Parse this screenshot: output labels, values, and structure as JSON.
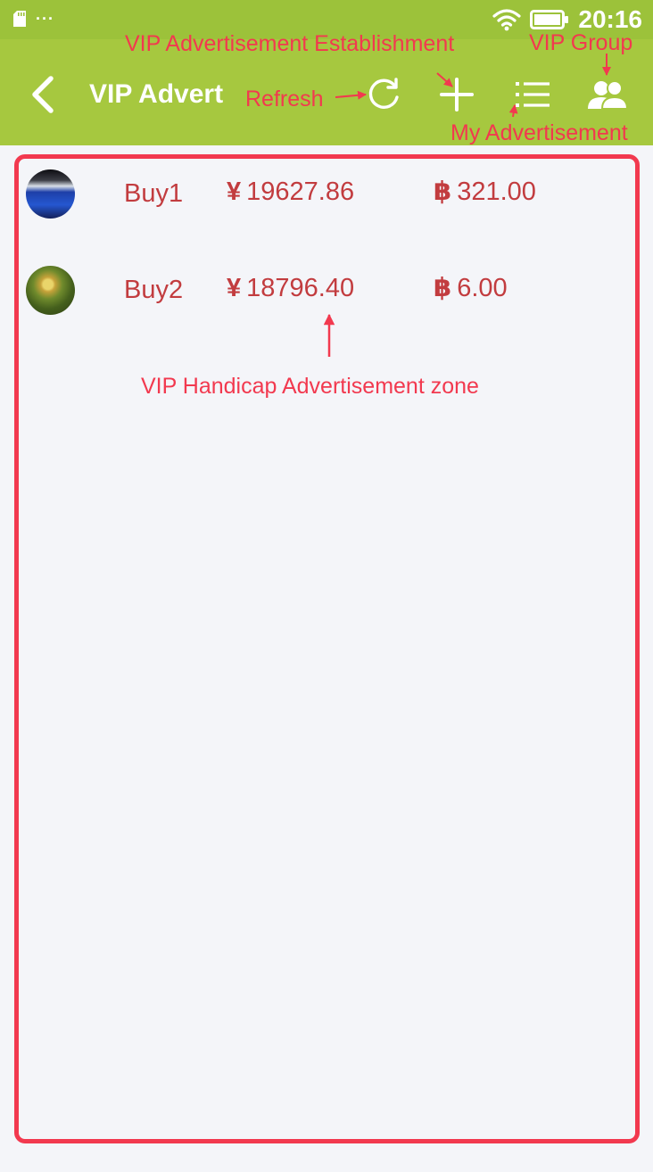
{
  "status_bar": {
    "time": "20:16",
    "more_indicator": "···",
    "icons": [
      "sd-card-icon",
      "wifi-icon",
      "battery-icon"
    ]
  },
  "app_bar": {
    "title": "VIP Advert",
    "actions": [
      "back-icon",
      "refresh-icon",
      "plus-icon",
      "list-icon",
      "group-icon"
    ]
  },
  "ads": [
    {
      "name": "Buy1",
      "currency_symbol": "¥",
      "price": "19627.86",
      "coin_symbol": "฿",
      "amount": "321.00"
    },
    {
      "name": "Buy2",
      "currency_symbol": "¥",
      "price": "18796.40",
      "coin_symbol": "฿",
      "amount": "6.00"
    }
  ],
  "annotations": {
    "establishment": "VIP Advertisement Establishment",
    "group": "VIP Group",
    "refresh": "Refresh",
    "my_ads": "My Advertisement",
    "zone": "VIP Handicap Advertisement zone"
  },
  "colors": {
    "status_bar": "#9cc23a",
    "app_bar": "#a6c83f",
    "background": "#f4f5f9",
    "ad_text": "#c23c3f",
    "annotation": "#f2394f"
  }
}
